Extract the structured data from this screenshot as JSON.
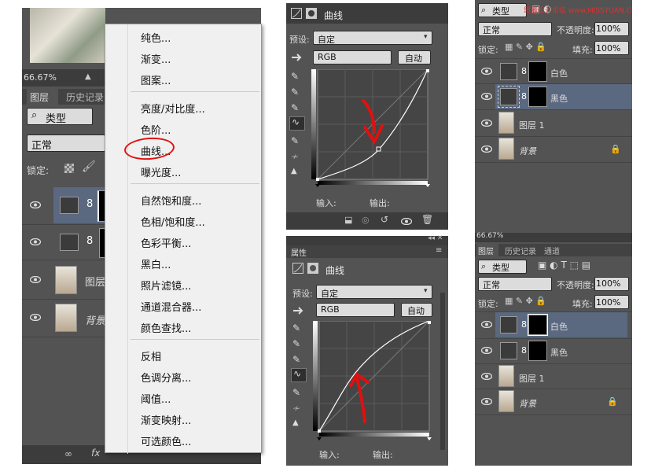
{
  "left": {
    "zoom": "66.67%",
    "tabs": [
      "图层",
      "历史记录"
    ],
    "filter_label": "类型",
    "blend_mode": "正常",
    "lock_label": "锁定:",
    "layers": [
      "图层",
      "背景"
    ],
    "menu": {
      "group1": [
        "纯色...",
        "渐变...",
        "图案..."
      ],
      "group2": [
        "亮度/对比度...",
        "曲线...",
        "曝光度..."
      ],
      "group2_item2": "色阶...",
      "group3": [
        "自然饱和度...",
        "色相/饱和度...",
        "色彩平衡...",
        "黑白...",
        "照片滤镜...",
        "通道混合器...",
        "颜色查找..."
      ],
      "group4": [
        "反相",
        "色调分离...",
        "阈值...",
        "渐变映射...",
        "可选颜色..."
      ]
    }
  },
  "curves_top": {
    "title": "曲线",
    "preset_label": "预设:",
    "preset_value": "自定",
    "channel": "RGB",
    "auto_button": "自动",
    "input_label": "输入:",
    "output_label": "输出:"
  },
  "curves_bottom": {
    "panel_title": "属性",
    "title": "曲线",
    "preset_label": "预设:",
    "preset_value": "自定",
    "channel": "RGB",
    "auto_button": "自动",
    "input_label": "输入:",
    "output_label": "输出:"
  },
  "layers_top": {
    "filter_label": "类型",
    "blend_mode": "正常",
    "opacity_label": "不透明度:",
    "opacity_value": "100%",
    "lock_label": "锁定:",
    "fill_label": "填充:",
    "fill_value": "100%",
    "layers": [
      "白色",
      "黑色",
      "图层 1",
      "背景"
    ],
    "watermark": "思缘设计论坛 www.MISSYUAN.COM"
  },
  "layers_bottom": {
    "zoom": "66.67%",
    "tabs": [
      "图层",
      "历史记录",
      "通道"
    ],
    "filter_label": "类型",
    "blend_mode": "正常",
    "opacity_label": "不透明度:",
    "opacity_value": "100%",
    "lock_label": "锁定:",
    "fill_label": "填充:",
    "fill_value": "100%",
    "layers": [
      "白色",
      "黑色",
      "图层 1",
      "背景"
    ]
  }
}
